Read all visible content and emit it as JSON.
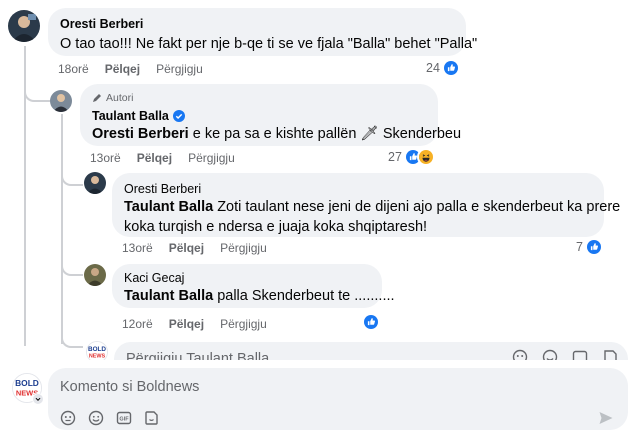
{
  "colors": {
    "like_blue": "#1877f2",
    "haha_yellow": "#f7b125",
    "bubble_bg": "#f0f2f5",
    "muted": "#65676b"
  },
  "comments": [
    {
      "author": "Oresti Berberi",
      "text": "O tao tao!!! Ne fakt per nje b-qe ti se ve fjala \"Balla\" behet \"Palla\"",
      "time": "18orë",
      "like": "Pëlqej",
      "reply": "Përgjigju",
      "reaction_count": "24",
      "reaction_icons": [
        "like-icon"
      ]
    },
    {
      "badge": "Autori",
      "author": "Taulant Balla",
      "verified": true,
      "mention": "Oresti Berberi",
      "text": " e ke pa sa e kishte pallën 🗡 Skenderbeu",
      "time": "13orë",
      "like": "Pëlqej",
      "reply": "Përgjigju",
      "reaction_count": "27",
      "reaction_icons": [
        "like-icon",
        "haha-icon"
      ]
    },
    {
      "author": "Oresti Berberi",
      "mention": "Taulant Balla",
      "text_line1": " Zoti taulant nese jeni de dijeni ajo palla e skenderbeut ka prere",
      "text_line2": "koka turqish e ndersa e juaja koka shqiptaresh!",
      "time": "13orë",
      "like": "Pëlqej",
      "reply": "Përgjigju",
      "reaction_count": "7",
      "reaction_icons": [
        "like-icon"
      ]
    },
    {
      "author": "Kaci Gecaj",
      "mention": "Taulant Balla",
      "text": " palla Skenderbeut te ..........",
      "time": "12orë",
      "like": "Pëlqej",
      "reply": "Përgjigju",
      "reaction_icons": [
        "like-icon"
      ]
    }
  ],
  "reply_box": {
    "placeholder": "Përgjigju Taulant Balla",
    "icons": [
      "sticker-face-icon",
      "emoji-icon",
      "gif-icon",
      "sticker-icon"
    ]
  },
  "composer": {
    "placeholder": "Komento si Boldnews",
    "avatar_text": "BOLD NEWS",
    "icons": [
      "sticker-face-icon",
      "emoji-icon",
      "gif-icon",
      "sticker-icon",
      "send-icon"
    ]
  }
}
